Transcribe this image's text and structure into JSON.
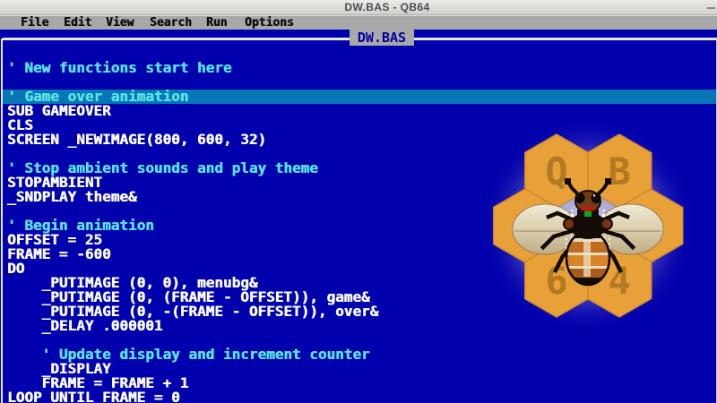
{
  "window": {
    "title": "DW.BAS - QB64"
  },
  "menu": {
    "items": [
      "File",
      "Edit",
      "View",
      "Search",
      "Run",
      "Options"
    ]
  },
  "tab": {
    "label": "DW.BAS"
  },
  "editor": {
    "lines": [
      {
        "text": "' New functions start here",
        "kind": "comment"
      },
      {
        "text": "",
        "kind": "code"
      },
      {
        "text": "' Game over animation",
        "kind": "comment",
        "highlighted": true
      },
      {
        "text": "SUB GAMEOVER",
        "kind": "code"
      },
      {
        "text": "CLS",
        "kind": "code"
      },
      {
        "text": "SCREEN _NEWIMAGE(800, 600, 32)",
        "kind": "code"
      },
      {
        "text": "",
        "kind": "code"
      },
      {
        "text": "' Stop ambient sounds and play theme",
        "kind": "comment"
      },
      {
        "text": "STOPAMBIENT",
        "kind": "code"
      },
      {
        "text": "_SNDPLAY theme&",
        "kind": "code"
      },
      {
        "text": "",
        "kind": "code"
      },
      {
        "text": "' Begin animation",
        "kind": "comment"
      },
      {
        "text": "OFFSET = 25",
        "kind": "code"
      },
      {
        "text": "FRAME = -600",
        "kind": "code"
      },
      {
        "text": "DO",
        "kind": "code"
      },
      {
        "text": "    _PUTIMAGE (0, 0), menubg&",
        "kind": "code"
      },
      {
        "text": "    _PUTIMAGE (0, (FRAME - OFFSET)), game&",
        "kind": "code"
      },
      {
        "text": "    _PUTIMAGE (0, -(FRAME - OFFSET)), over&",
        "kind": "code"
      },
      {
        "text": "    _DELAY .000001",
        "kind": "code"
      },
      {
        "text": "",
        "kind": "code"
      },
      {
        "text": "    ' Update display and increment counter",
        "kind": "comment"
      },
      {
        "text": "    _DISPLAY",
        "kind": "code"
      },
      {
        "text": "    FRAME = FRAME + 1",
        "kind": "code"
      },
      {
        "text": "LOOP UNTIL FRAME = 0",
        "kind": "code"
      }
    ]
  },
  "logo": {
    "letters": [
      "Q",
      "B",
      "6",
      "4"
    ]
  },
  "colors": {
    "editor_bg": "#0000AC",
    "current_line_bg": "#0875B5",
    "comment_text": "#57E2E8",
    "code_text": "#FCFCFC",
    "menubar_bg": "#A8A8A8",
    "titlebar_bg": "#DFDDD9",
    "border_line": "#EAEAEA",
    "tab_bg": "#A8A8A8",
    "tab_text": "#0000A0",
    "hex_fill": "#E8A038",
    "hex_letter": "#AD761F"
  }
}
